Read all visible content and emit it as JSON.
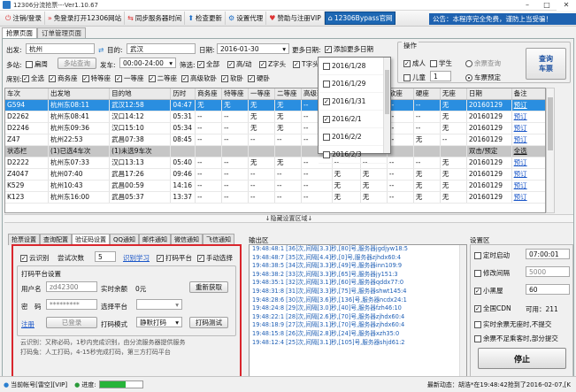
{
  "window": {
    "title": "12306分流抢票---Ver1.10.67"
  },
  "toolbar": [
    {
      "label": "注销/登录",
      "icon": "power-icon",
      "color": "#d33"
    },
    {
      "label": "免登录打开12306网站",
      "icon": "double-arrow-icon",
      "color": "#d33"
    },
    {
      "label": "同步服务器时间",
      "icon": "sync-icon",
      "color": "#d33"
    },
    {
      "label": "检查更新",
      "icon": "upload-icon",
      "color": "#1e6fc8"
    },
    {
      "label": "设置代理",
      "icon": "gear-icon",
      "color": "#1e6fc8"
    },
    {
      "label": "赞助与注册VIP",
      "icon": "heart-icon",
      "color": "#d33"
    },
    {
      "label": "12306Bypass官网",
      "icon": "home-icon",
      "color": "#fff"
    }
  ],
  "announcement": "公告：本程序完全免费，谨防上当受骗！",
  "main_tabs": [
    "抢票页面",
    "订单管理页面"
  ],
  "query": {
    "from_label": "出发:",
    "from_value": "杭州",
    "to_label": "目的:",
    "to_value": "武汉",
    "date_label": "日期:",
    "date_value": "2016-01-30",
    "more_dates_label": "更多日期:",
    "add_more_dates": "添加更多日期",
    "station_label": "多站:",
    "station_value": "扁周",
    "multi_query_btn": "多站查询",
    "depart_label": "发车:",
    "depart_value": "00:00-24:00",
    "filter_label": "筛选:",
    "filters": [
      "全部",
      "高/动",
      "Z字头",
      "T字头"
    ],
    "seat_label": "席别:",
    "seats": [
      "全选",
      "商务座",
      "特等座",
      "一等座",
      "二等座",
      "高级软卧",
      "软卧",
      "硬卧"
    ]
  },
  "operations": {
    "title": "操作",
    "adult": "成人",
    "student": "学生",
    "child": "儿童",
    "child_count": "1",
    "remaining_query": "余票查询",
    "book": "车票预定",
    "query_btn": "查询\n车票"
  },
  "date_dropdown": [
    {
      "date": "2016/1/28",
      "checked": false
    },
    {
      "date": "2016/1/29",
      "checked": false
    },
    {
      "date": "2016/1/31",
      "checked": true
    },
    {
      "date": "2016/2/1",
      "checked": true
    },
    {
      "date": "2016/2/2",
      "checked": false
    },
    {
      "date": "2016/2/3",
      "checked": false
    }
  ],
  "grid": {
    "columns": [
      "车次",
      "出发地",
      "目的地",
      "历时",
      "商务座",
      "特等座",
      "一等座",
      "二等座",
      "高级软卧",
      "软卧",
      "硬卧",
      "软座",
      "硬座",
      "无座",
      "日期",
      "备注"
    ],
    "rows": [
      {
        "cells": [
          "G594",
          "杭州东08:11",
          "武汉12:58",
          "04:47",
          "无",
          "无",
          "无",
          "无",
          "--",
          "--",
          "--",
          "--",
          "--",
          "无",
          "20160129",
          "预订"
        ],
        "sel": true
      },
      {
        "cells": [
          "D2262",
          "杭州东08:41",
          "汉口14:12",
          "05:31",
          "--",
          "--",
          "无",
          "无",
          "--",
          "--",
          "--",
          "--",
          "--",
          "无",
          "20160129",
          "预订"
        ]
      },
      {
        "cells": [
          "D2246",
          "杭州东09:36",
          "汉口15:10",
          "05:34",
          "--",
          "--",
          "无",
          "无",
          "--",
          "--",
          "--",
          "--",
          "--",
          "无",
          "20160129",
          "预订"
        ]
      },
      {
        "cells": [
          "Z47",
          "杭州22:53",
          "武昌07:38",
          "08:45",
          "--",
          "--",
          "--",
          "--",
          "--",
          "--",
          "无",
          "--",
          "无",
          "--",
          "20160129",
          "预订"
        ]
      },
      {
        "cells": [
          "状态栏",
          "(1)已选4车次",
          "(1)未选9车次",
          "",
          "",
          "",
          "",
          "",
          "",
          "",
          "",
          "",
          "",
          "",
          "双击/预定",
          "全选"
        ],
        "hdr": true
      },
      {
        "cells": [
          "D2222",
          "杭州东07:33",
          "汉口13:13",
          "05:40",
          "--",
          "--",
          "无",
          "无",
          "--",
          "--",
          "--",
          "--",
          "--",
          "无",
          "20160129",
          "预订"
        ]
      },
      {
        "cells": [
          "Z4047",
          "杭州07:40",
          "武昌17:26",
          "09:46",
          "--",
          "--",
          "--",
          "--",
          "--",
          "无",
          "无",
          "--",
          "无",
          "无",
          "20160129",
          "预订"
        ]
      },
      {
        "cells": [
          "K529",
          "杭州10:43",
          "武昌00:59",
          "14:16",
          "--",
          "--",
          "--",
          "--",
          "--",
          "无",
          "无",
          "--",
          "无",
          "无",
          "20160129",
          "预订"
        ]
      },
      {
        "cells": [
          "K123",
          "杭州东16:00",
          "武昌05:37",
          "13:37",
          "--",
          "--",
          "--",
          "--",
          "--",
          "无",
          "无",
          "--",
          "无",
          "无",
          "20160129",
          "预订"
        ]
      }
    ]
  },
  "hide_bar": "↓隐藏设置区域↓",
  "sub_tabs": [
    "抢票设置",
    "查询配置",
    "验证码设置",
    "QQ通知",
    "邮件通知",
    "微信通知",
    "飞信通知"
  ],
  "captcha": {
    "cloud_id": "云识别",
    "try_times_label": "尝试次数",
    "try_times": "5",
    "learn": "识别学习",
    "platform": "打码平台",
    "manual": "手动选择",
    "platform_title": "打码平台设置",
    "username_label": "用户名",
    "username_value": "zd42300",
    "balance_label": "实时余额",
    "balance_value": "0元",
    "refresh_btn": "重新获取",
    "password_label": "密　码",
    "password_value": "*********",
    "select_platform_label": "选择平台",
    "register": "注册",
    "logged_in": "已登录",
    "mode_label": "打码模式",
    "mode_value": "静默打码",
    "test_btn": "打码测试",
    "info1": "云识别：又称必码，1秒内完成识别，由分流服务器提供服务",
    "info2": "打码兔：人工打码，4-15秒完成打码，第三方打码平台"
  },
  "log_title": "输出区",
  "log": [
    "19:48:48:1  [36]次,间隔[3.3]秒,[80]号,服务器jgdjyw18:5",
    "19:48:48:7  [35]次,间隔[4.4]秒,[0]号,服务器zjhdx60:4",
    "19:48:38:5  [34]次,间隔[3.3]秒,[49]号,服务器inn109:9",
    "19:48:38:2  [33]次,间隔[3.3]秒,[65]号,服务器jy151:3",
    "19:48:35:1  [32]次,间隔[3.1]秒,[60]号,服务器qddx77:0",
    "19:48:31:8  [31]次,间隔[3.3]秒,[75]号,服务器shwt145:4",
    "19:48:28:6  [30]次,间隔[3.6]秒,[136]号,服务器ncdx24:1",
    "19:48:24:8  [29]次,间隔[3.0]秒,[40]号,服务器fzh46:10",
    "19:48:22:1  [28]次,间隔[2.6]秒,[70]号,服务器zjhdx60:4",
    "19:48:18:9  [27]次,间隔[3.1]秒,[70]号,服务器zjhdx60:4",
    "19:48:15:8  [26]次,间隔[2.8]秒,[24]号,服务器xzh35:0",
    "19:48:12:4  [25]次,间隔[3.1]秒,[105]号,服务器shjd61:2"
  ],
  "settings": {
    "title": "设置区",
    "timer_label": "定时启动",
    "timer_value": "07:00:01",
    "interval_label": "修改间隔",
    "interval_value": "5000",
    "blackroom_label": "小黑屋",
    "blackroom_value": "60",
    "cdn_label": "全国CDN",
    "cdn_value": "可用：211",
    "realtime_label": "实时余票无座时,不提交",
    "partial_label": "余票不足乘客时,部分提交",
    "stop_btn": "停止"
  },
  "status": {
    "account": "当前帐号[雷空][VIP]",
    "progress_label": "进度:",
    "progress": 0.62,
    "latest": "最新动态：胡浩*在19:48:42抢到了2016-02-07,[K"
  }
}
